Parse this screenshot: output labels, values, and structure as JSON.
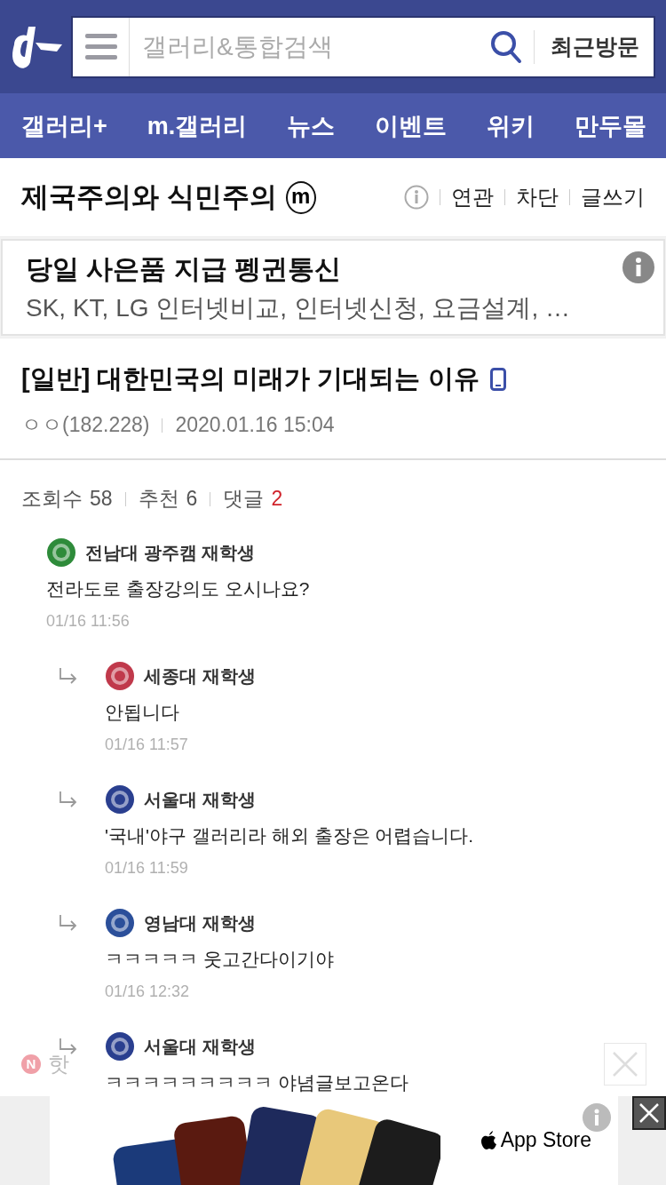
{
  "header": {
    "search": {
      "placeholder": "갤러리&통합검색"
    },
    "recent_button": "최근방문"
  },
  "nav": [
    {
      "label": "갤러리+"
    },
    {
      "label": "m.갤러리"
    },
    {
      "label": "뉴스"
    },
    {
      "label": "이벤트"
    },
    {
      "label": "위키"
    },
    {
      "label": "만두몰"
    }
  ],
  "gallery": {
    "title": "제국주의와 식민주의",
    "badge": "m",
    "links": [
      "연관",
      "차단",
      "글쓰기"
    ]
  },
  "ad": {
    "title": "당일 사은품 지급 펭귄통신",
    "text": "SK, KT, LG 인터넷비교, 인터넷신청, 요금설계, …"
  },
  "post": {
    "title": "[일반] 대한민국의 미래가 기대되는 이유",
    "mobile": true,
    "author": "ㅇㅇ(182.228)",
    "date": "2020.01.16 15:04"
  },
  "stats": [
    {
      "label": "조회수",
      "value": "58",
      "highlight": false
    },
    {
      "label": "추천",
      "value": "6",
      "highlight": false
    },
    {
      "label": "댓글",
      "value": "2",
      "highlight": true
    }
  ],
  "comments": [
    {
      "reply": false,
      "color": "#2e8b3a",
      "author": "전남대 광주캠 재학생",
      "text": "전라도로 출장강의도 오시나요?",
      "time": "01/16 11:56"
    },
    {
      "reply": true,
      "color": "#c0394b",
      "author": "세종대 재학생",
      "text": "안됩니다",
      "time": "01/16 11:57"
    },
    {
      "reply": true,
      "color": "#2a3f8f",
      "author": "서울대 재학생",
      "text": "'국내'야구 갤러리라 해외 출장은 어렵습니다.",
      "time": "01/16 11:59"
    },
    {
      "reply": true,
      "color": "#2b4f9a",
      "author": "영남대 재학생",
      "text": "ㅋㅋㅋㅋㅋ 웃고간다이기야",
      "time": "01/16 12:32"
    },
    {
      "reply": true,
      "color": "#2a3f8f",
      "author": "서울대 재학생",
      "text": "ㅋㅋㅋㅋㅋㅋㅋㅋㅋ 야념글보고온다"
    }
  ],
  "notice": {
    "badge": "N",
    "label": "핫"
  },
  "bottom_ad": {
    "store": "App Store"
  }
}
